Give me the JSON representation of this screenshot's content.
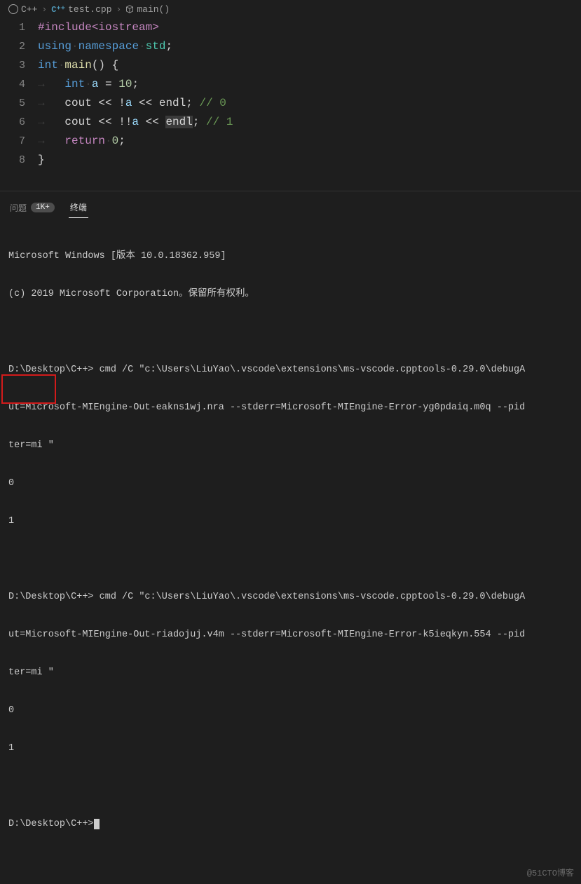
{
  "breadcrumb": {
    "lang": "C++",
    "file": "test.cpp",
    "symbol": "main()"
  },
  "gutter": [
    "1",
    "2",
    "3",
    "4",
    "5",
    "6",
    "7",
    "8"
  ],
  "code": {
    "l1": {
      "include": "#include",
      "header": "<iostream>"
    },
    "l2": {
      "using": "using",
      "namespace": "namespace",
      "std": "std",
      "semi": ";"
    },
    "l3": {
      "int": "int",
      "main": "main",
      "paren": "()",
      "brace": " {"
    },
    "l4": {
      "indent": "    ",
      "int": "int",
      "a": "a",
      "eq": " = ",
      "num": "10",
      "semi": ";"
    },
    "l5": {
      "indent": "    ",
      "cout": "cout",
      "op1": " << ",
      "bang": "!",
      "a": "a",
      "op2": " << ",
      "endl": "endl",
      "semi": ";",
      "comment": " // 0"
    },
    "l6": {
      "indent": "    ",
      "cout": "cout",
      "op1": " << ",
      "bang": "!!",
      "a": "a",
      "op2": " << ",
      "endl": "endl",
      "semi": ";",
      "comment": " // 1"
    },
    "l7": {
      "indent": "    ",
      "return": "return",
      "zero": "0",
      "semi": ";"
    },
    "l8": {
      "brace": "}"
    }
  },
  "tabs": {
    "problems": "问题",
    "problems_count": "1K+",
    "terminal": "终端"
  },
  "terminal": {
    "lines": [
      "Microsoft Windows [版本 10.0.18362.959]",
      "(c) 2019 Microsoft Corporation。保留所有权利。",
      "",
      "D:\\Desktop\\C++> cmd /C \"c:\\Users\\LiuYao\\.vscode\\extensions\\ms-vscode.cpptools-0.29.0\\debugA",
      "ut=Microsoft-MIEngine-Out-eakns1wj.nra --stderr=Microsoft-MIEngine-Error-yg0pdaiq.m0q --pid",
      "ter=mi \"",
      "0",
      "1",
      "",
      "D:\\Desktop\\C++> cmd /C \"c:\\Users\\LiuYao\\.vscode\\extensions\\ms-vscode.cpptools-0.29.0\\debugA",
      "ut=Microsoft-MIEngine-Out-riadojuj.v4m --stderr=Microsoft-MIEngine-Error-k5ieqkyn.554 --pid",
      "ter=mi \"",
      "0",
      "1",
      "",
      "D:\\Desktop\\C++>"
    ]
  },
  "watermark": "@51CTO博客"
}
